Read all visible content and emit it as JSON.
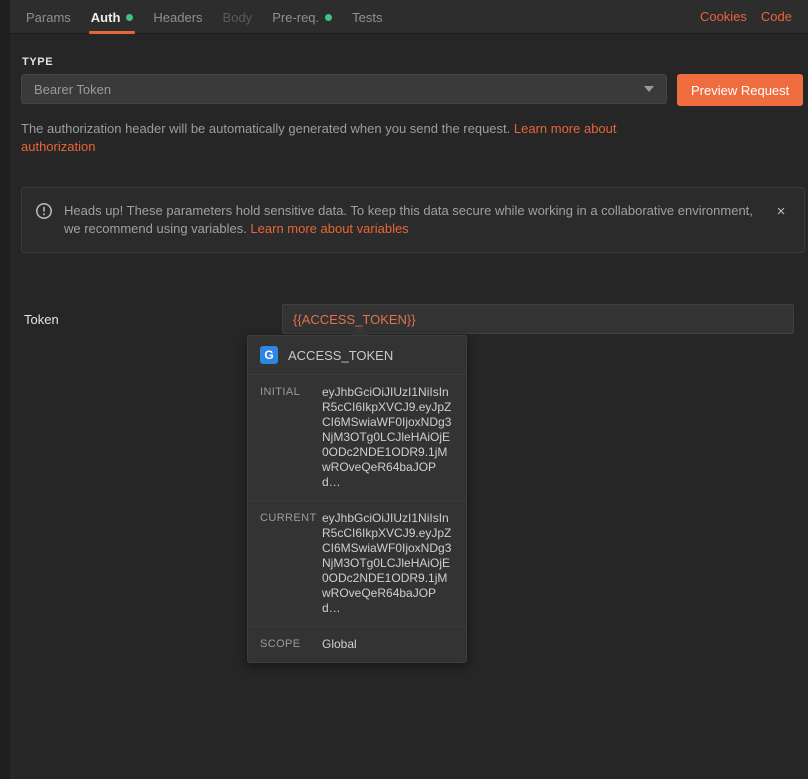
{
  "theme": {
    "background": "#262626",
    "panel": "#2d2d2d",
    "accent_orange": "#e8653a",
    "button_orange": "#ef6c3e",
    "status_green": "#3dc184",
    "badge_blue": "#2d86e0",
    "variable_text": "#e0724d"
  },
  "tabbar": {
    "tabs": [
      {
        "label": "Params",
        "active": false,
        "disabled": false,
        "has_dot": false
      },
      {
        "label": "Auth",
        "active": true,
        "disabled": false,
        "has_dot": true
      },
      {
        "label": "Headers",
        "active": false,
        "disabled": false,
        "has_dot": false
      },
      {
        "label": "Body",
        "active": false,
        "disabled": true,
        "has_dot": false
      },
      {
        "label": "Pre-req.",
        "active": false,
        "disabled": false,
        "has_dot": true
      },
      {
        "label": "Tests",
        "active": false,
        "disabled": false,
        "has_dot": false
      }
    ],
    "cookies_link": "Cookies",
    "code_link": "Code"
  },
  "auth": {
    "type_label": "TYPE",
    "type_value": "Bearer Token",
    "preview_button": "Preview Request",
    "description_text": "The authorization header will be automatically generated when you send the request. ",
    "description_link": "Learn more about authorization"
  },
  "banner": {
    "icon": "info-exclamation-icon",
    "text": "Heads up! These parameters hold sensitive data. To keep this data secure while working in a collaborative environment, we recommend using variables. ",
    "link": "Learn more about variables",
    "close_label": "×"
  },
  "token_row": {
    "label": "Token",
    "value": "{{ACCESS_TOKEN}}",
    "placeholder": "Token"
  },
  "variable_tooltip": {
    "scope_badge": "G",
    "name": "ACCESS_TOKEN",
    "rows": [
      {
        "key": "INITIAL",
        "value": "eyJhbGciOiJIUzI1NiIsInR5cCI6IkpXVCJ9.eyJpZCI6MSwiaWF0IjoxNDg3NjM3OTg0LCJleHAiOjE0ODc2NDE1ODR9.1jMwROveQeR64baJOPd…"
      },
      {
        "key": "CURRENT",
        "value": "eyJhbGciOiJIUzI1NiIsInR5cCI6IkpXVCJ9.eyJpZCI6MSwiaWF0IjoxNDg3NjM3OTg0LCJleHAiOjE0ODc2NDE1ODR9.1jMwROveQeR64baJOPd…"
      },
      {
        "key": "SCOPE",
        "value": "Global"
      }
    ]
  }
}
